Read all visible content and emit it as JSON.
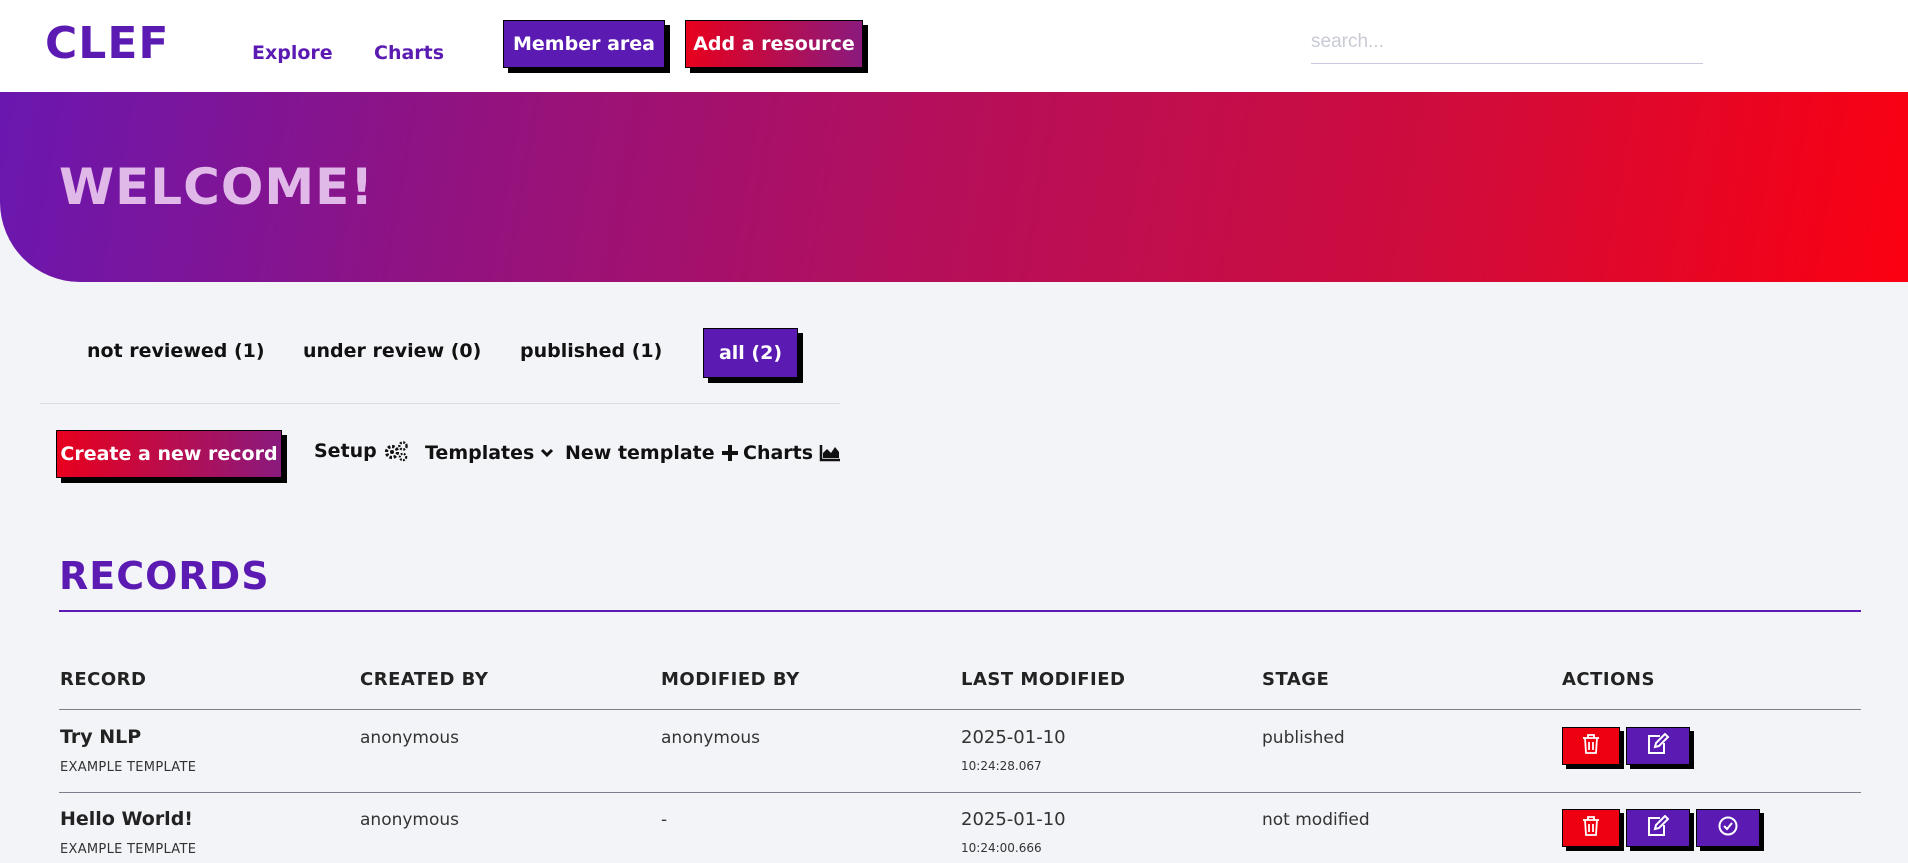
{
  "header": {
    "logo": "CLEF",
    "nav": [
      "Explore",
      "Charts"
    ],
    "member_area": "Member area",
    "add_resource": "Add a resource",
    "search_placeholder": "search..."
  },
  "banner": {
    "title": "WELCOME!"
  },
  "stage_tabs": [
    {
      "label": "not reviewed (1)",
      "active": false
    },
    {
      "label": "under review (0)",
      "active": false
    },
    {
      "label": "published (1)",
      "active": false
    },
    {
      "label": "all (2)",
      "active": true
    }
  ],
  "toolbar": {
    "create": "Create a new record",
    "setup": "Setup",
    "templates": "Templates",
    "new_template": "New template",
    "charts": "Charts"
  },
  "records": {
    "title": "RECORDS",
    "columns": [
      "RECORD",
      "CREATED BY",
      "MODIFIED BY",
      "LAST MODIFIED",
      "STAGE",
      "ACTIONS"
    ],
    "rows": [
      {
        "title": "Try NLP",
        "template": "EXAMPLE TEMPLATE",
        "created_by": "anonymous",
        "modified_by": "anonymous",
        "date": "2025-01-10",
        "time": "10:24:28.067",
        "stage": "published"
      },
      {
        "title": "Hello World!",
        "template": "EXAMPLE TEMPLATE",
        "created_by": "anonymous",
        "modified_by": "-",
        "date": "2025-01-10",
        "time": "10:24:00.666",
        "stage": "not modified"
      }
    ]
  },
  "icons": {
    "delete": "trash-icon",
    "edit": "edit-icon",
    "publish": "check-circle-icon",
    "setup": "gears-icon",
    "templates": "chevron-down-icon",
    "new_template": "plus-icon",
    "charts": "area-chart-icon"
  },
  "colors": {
    "primary": "#5b1bb3",
    "danger": "#ee0010"
  }
}
